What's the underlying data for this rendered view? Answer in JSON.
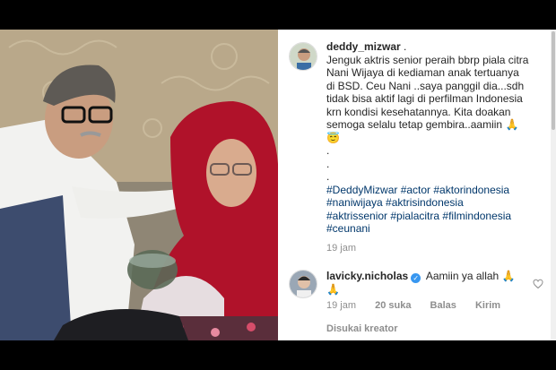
{
  "post": {
    "username": "deddy_mizwar",
    "caption_lines": [
      "Jenguk aktris senior peraih bbrp piala citra",
      "Nani Wijaya di kediaman anak tertuanya",
      "di BSD. Ceu Nani ..saya panggil dia...sdh",
      "tidak bisa aktif lagi di perfilman Indonesia",
      "krn kondisi kesehatannya. Kita doakan",
      "semoga selalu tetap gembira..aamiin 🙏",
      "😇"
    ],
    "dots": [
      ".",
      ".",
      "."
    ],
    "hashtags": [
      "#DeddyMizwar #actor #aktorindonesia",
      "#naniwijaya #aktrisindonesia",
      "#aktrissenior #pialacitra #filmindonesia",
      "#ceunani"
    ],
    "time": "19 jam"
  },
  "comment": {
    "username": "lavicky.nicholas",
    "verified_mark": "✓",
    "text": "Aamiin ya allah 🙏",
    "text_cont": "🙏",
    "time": "19 jam",
    "likes": "20 suka",
    "reply": "Balas",
    "send": "Kirim",
    "liked_by_creator": "Disukai kreator"
  },
  "colors": {
    "hashtag": "#00376b",
    "meta": "#8e8e8e",
    "verified": "#3897f0",
    "hijab": "#b0122a"
  },
  "icons": [
    "heart-icon",
    "verified-badge-icon"
  ]
}
